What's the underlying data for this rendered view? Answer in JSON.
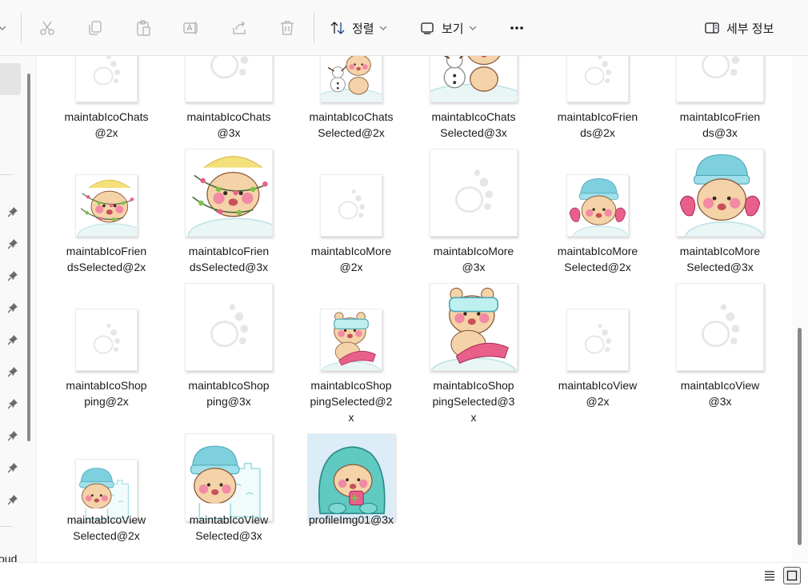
{
  "toolbar": {
    "sort_label": "정렬",
    "view_label": "보기",
    "details_label": "세부 정보",
    "icons": [
      "cut-icon",
      "copy-icon",
      "paste-icon",
      "rename-icon",
      "share-icon",
      "delete-icon",
      "sort-icon",
      "view-icon",
      "more-icon",
      "details-pane-icon"
    ]
  },
  "nav": {
    "partial_text": "oud"
  },
  "files": [
    {
      "name": "maintabIcoChats@2x",
      "line1": "maintabIcoChats",
      "line2": "@2x",
      "line3": "",
      "size": "small",
      "art": "paw"
    },
    {
      "name": "maintabIcoChats@3x",
      "line1": "maintabIcoChats",
      "line2": "@3x",
      "line3": "",
      "size": "large",
      "art": "paw"
    },
    {
      "name": "maintabIcoChatsSelected@2x",
      "line1": "maintabIcoChats",
      "line2": "Selected@2x",
      "line3": "",
      "size": "small",
      "art": "snowman"
    },
    {
      "name": "maintabIcoChatsSelected@3x",
      "line1": "maintabIcoChats",
      "line2": "Selected@3x",
      "line3": "",
      "size": "large",
      "art": "snowman"
    },
    {
      "name": "maintabIcoFriends@2x",
      "line1": "maintabIcoFrien",
      "line2": "ds@2x",
      "line3": "",
      "size": "small",
      "art": "paw"
    },
    {
      "name": "maintabIcoFriends@3x",
      "line1": "maintabIcoFrien",
      "line2": "ds@3x",
      "line3": "",
      "size": "large",
      "art": "paw"
    },
    {
      "name": "maintabIcoFriendsSelected@2x",
      "line1": "maintabIcoFrien",
      "line2": "dsSelected@2x",
      "line3": "",
      "size": "small",
      "art": "lights"
    },
    {
      "name": "maintabIcoFriendsSelected@3x",
      "line1": "maintabIcoFrien",
      "line2": "dsSelected@3x",
      "line3": "",
      "size": "large",
      "art": "lights"
    },
    {
      "name": "maintabIcoMore@2x",
      "line1": "maintabIcoMore",
      "line2": "@2x",
      "line3": "",
      "size": "small",
      "art": "paw"
    },
    {
      "name": "maintabIcoMore@3x",
      "line1": "maintabIcoMore",
      "line2": "@3x",
      "line3": "",
      "size": "large",
      "art": "paw"
    },
    {
      "name": "maintabIcoMoreSelected@2x",
      "line1": "maintabIcoMore",
      "line2": "Selected@2x",
      "line3": "",
      "size": "small",
      "art": "mittens"
    },
    {
      "name": "maintabIcoMoreSelected@3x",
      "line1": "maintabIcoMore",
      "line2": "Selected@3x",
      "line3": "",
      "size": "large",
      "art": "mittens"
    },
    {
      "name": "maintabIcoShopping@2x",
      "line1": "maintabIcoShop",
      "line2": "ping@2x",
      "line3": "",
      "size": "small",
      "art": "paw"
    },
    {
      "name": "maintabIcoShopping@3x",
      "line1": "maintabIcoShop",
      "line2": "ping@3x",
      "line3": "",
      "size": "large",
      "art": "paw"
    },
    {
      "name": "maintabIcoShoppingSelected@2x",
      "line1": "maintabIcoShop",
      "line2": "pingSelected@2",
      "line3": "x",
      "size": "small",
      "art": "goggles"
    },
    {
      "name": "maintabIcoShoppingSelected@3x",
      "line1": "maintabIcoShop",
      "line2": "pingSelected@3",
      "line3": "x",
      "size": "large",
      "art": "goggles"
    },
    {
      "name": "maintabIcoView@2x",
      "line1": "maintabIcoView",
      "line2": "@2x",
      "line3": "",
      "size": "small",
      "art": "paw"
    },
    {
      "name": "maintabIcoView@3x",
      "line1": "maintabIcoView",
      "line2": "@3x",
      "line3": "",
      "size": "large",
      "art": "paw"
    },
    {
      "name": "maintabIcoViewSelected@2x",
      "line1": "maintabIcoView",
      "line2": "Selected@2x",
      "line3": "",
      "size": "small",
      "art": "castle"
    },
    {
      "name": "maintabIcoViewSelected@3x",
      "line1": "maintabIcoView",
      "line2": "Selected@3x",
      "line3": "",
      "size": "large",
      "art": "castle"
    },
    {
      "name": "profileImg01@3x",
      "line1": "profileImg01@3x",
      "line2": "",
      "line3": "",
      "size": "large",
      "art": "blanket"
    }
  ],
  "colors": {
    "bear_fur": "#f5d3a8",
    "cheek": "#f28aa4",
    "beanie": "#7fd0de",
    "pink_accent": "#e8608a",
    "snow": "#ffffff",
    "blanket": "#5fc9c2",
    "profile_bg": "#dcedf8",
    "paw_gray": "#e6e6e6"
  },
  "statusbar": {
    "icons": [
      "details-view-icon",
      "large-icons-view-icon"
    ]
  }
}
